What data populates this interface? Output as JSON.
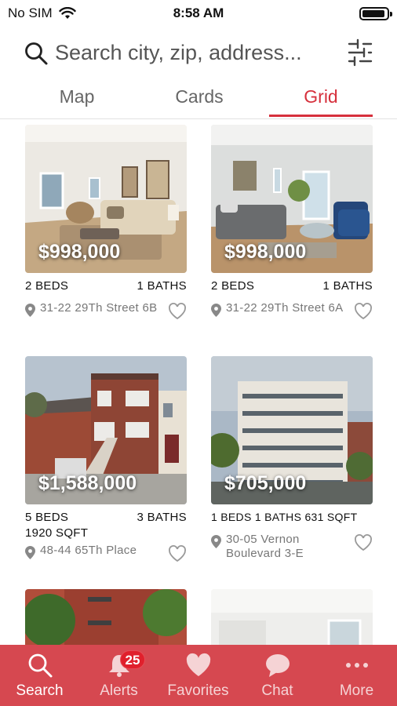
{
  "status_bar": {
    "carrier": "No SIM",
    "time": "8:58 AM"
  },
  "search": {
    "placeholder": "Search city, zip, address..."
  },
  "tabs": [
    {
      "label": "Map",
      "active": false
    },
    {
      "label": "Cards",
      "active": false
    },
    {
      "label": "Grid",
      "active": true
    }
  ],
  "listings": [
    {
      "price": "$998,000",
      "beds": "2 BEDS",
      "baths": "1 BATHS",
      "sqft": "",
      "address": "31-22 29Th Street 6B",
      "favorited": false
    },
    {
      "price": "$998,000",
      "beds": "2 BEDS",
      "baths": "1 BATHS",
      "sqft": "",
      "address": "31-22 29Th Street 6A",
      "favorited": false
    },
    {
      "price": "$1,588,000",
      "beds": "5 BEDS",
      "baths": "3 BATHS",
      "sqft": "1920 SQFT",
      "address": "48-44 65Th Place",
      "favorited": false
    },
    {
      "price": "$705,000",
      "beds": "1 BEDS",
      "baths": "1 BATHS",
      "sqft": "631 SQFT",
      "address": "30-05 Vernon Boulevard 3-E",
      "favorited": false
    }
  ],
  "bottom_nav": [
    {
      "label": "Search",
      "icon": "search-icon",
      "active": true
    },
    {
      "label": "Alerts",
      "icon": "bell-icon",
      "badge": "25",
      "active": false
    },
    {
      "label": "Favorites",
      "icon": "heart-icon",
      "active": false
    },
    {
      "label": "Chat",
      "icon": "chat-bubble-icon",
      "active": false
    },
    {
      "label": "More",
      "icon": "more-dots-icon",
      "active": false
    }
  ],
  "colors": {
    "accent": "#d6303c",
    "nav_background": "#d64850",
    "badge": "#e0202c"
  }
}
